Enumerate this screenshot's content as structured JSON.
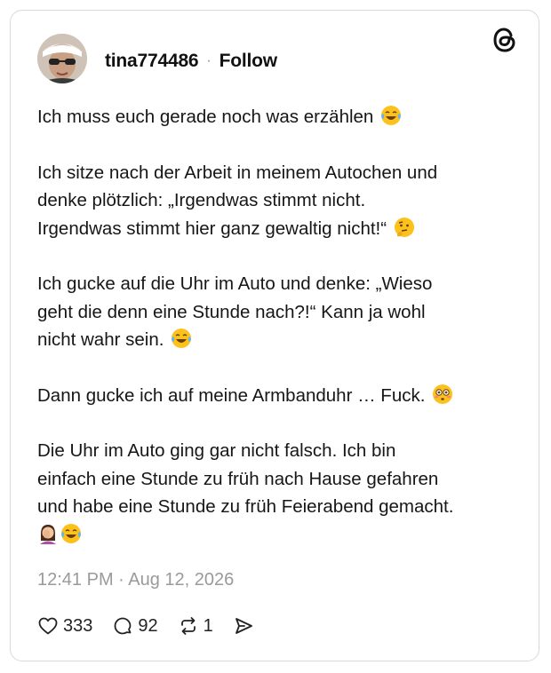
{
  "post": {
    "username": "tina774486",
    "separator": "·",
    "follow_label": "Follow",
    "paragraphs": [
      [
        "Ich muss euch gerade noch was erzählen"
      ],
      [
        "Ich sitze nach der Arbeit in meinem Autochen und",
        "denke plötzlich: „Irgendwas stimmt nicht.",
        "Irgendwas stimmt hier ganz gewaltig nicht!“"
      ],
      [
        "Ich gucke auf die Uhr im Auto und denke: „Wieso",
        "geht die denn eine Stunde nach?!“ Kann ja wohl",
        "nicht wahr sein."
      ],
      [
        "Dann gucke ich auf meine Armbanduhr … Fuck."
      ],
      [
        "Die Uhr im Auto ging gar nicht falsch. Ich bin",
        "einfach eine Stunde zu früh nach Hause gefahren",
        "und habe eine Stunde zu früh Feierabend gemacht."
      ]
    ],
    "emojis": [
      "tears-of-joy-emoji",
      "thinking-face-emoji",
      "tears-of-joy-emoji",
      "flushed-face-emoji",
      "woman-facepalming-emoji",
      "tears-of-joy-emoji"
    ],
    "timestamp": "12:41 PM · Aug 12, 2026",
    "likes": "333",
    "replies": "92",
    "reposts": "1"
  },
  "icons": [
    "threads-logo-icon",
    "heart-icon",
    "reply-icon",
    "repost-icon",
    "share-icon"
  ]
}
